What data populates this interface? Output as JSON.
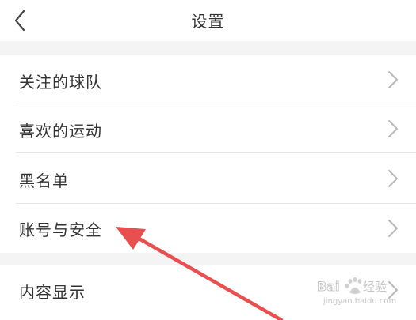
{
  "header": {
    "title": "设置",
    "back_icon": "chevron-left-icon"
  },
  "menu": {
    "items": [
      {
        "label": "关注的球队",
        "icon": "chevron-right-icon"
      },
      {
        "label": "喜欢的运动",
        "icon": "chevron-right-icon"
      },
      {
        "label": "黑名单",
        "icon": "chevron-right-icon"
      },
      {
        "label": "账号与安全",
        "icon": "chevron-right-icon"
      },
      {
        "label": "内容显示",
        "icon": "chevron-right-icon"
      }
    ]
  },
  "annotation": {
    "color": "#e8504f",
    "icon": "red-arrow-annotation"
  },
  "watermark": {
    "text": "Baidu经验",
    "domain": "jingyan.baidu.com"
  },
  "colors": {
    "background": "#f4f4f4",
    "row_background": "#ffffff",
    "text": "#333333",
    "chevron": "#b8b8b8"
  }
}
